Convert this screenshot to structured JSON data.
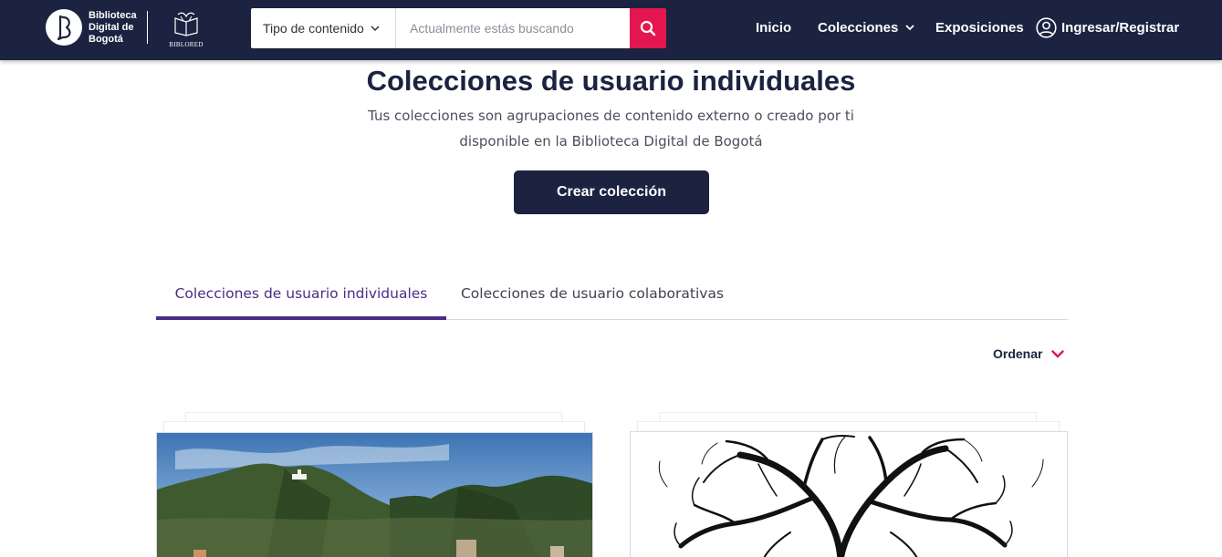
{
  "header": {
    "logo_lines": [
      "Biblioteca",
      "Digital de",
      "Bogotá"
    ],
    "secondary_logo": "BIBLORED",
    "search": {
      "type_label": "Tipo de contenido",
      "placeholder": "Actualmente estás buscando",
      "button_icon": "search-icon"
    },
    "nav": {
      "inicio": "Inicio",
      "colecciones": "Colecciones",
      "exposiciones": "Exposiciones",
      "login": "Ingresar/Registrar"
    }
  },
  "hero": {
    "title": "Colecciones de usuario individuales",
    "subtitle_line1": "Tus colecciones son agrupaciones de contenido externo o creado por ti",
    "subtitle_line2": "disponible en la Biblioteca Digital de Bogotá",
    "create_button": "Crear colección"
  },
  "tabs": [
    {
      "label": "Colecciones de usuario individuales",
      "active": true
    },
    {
      "label": "Colecciones de usuario colaborativas",
      "active": false
    }
  ],
  "order_label": "Ordenar",
  "colors": {
    "navy": "#1b2340",
    "accent_red": "#e4164f",
    "tab_purple": "#4b2c86"
  },
  "cards": [
    {
      "image": "bogota-mountains-photo"
    },
    {
      "image": "tree-branches-illustration"
    }
  ]
}
